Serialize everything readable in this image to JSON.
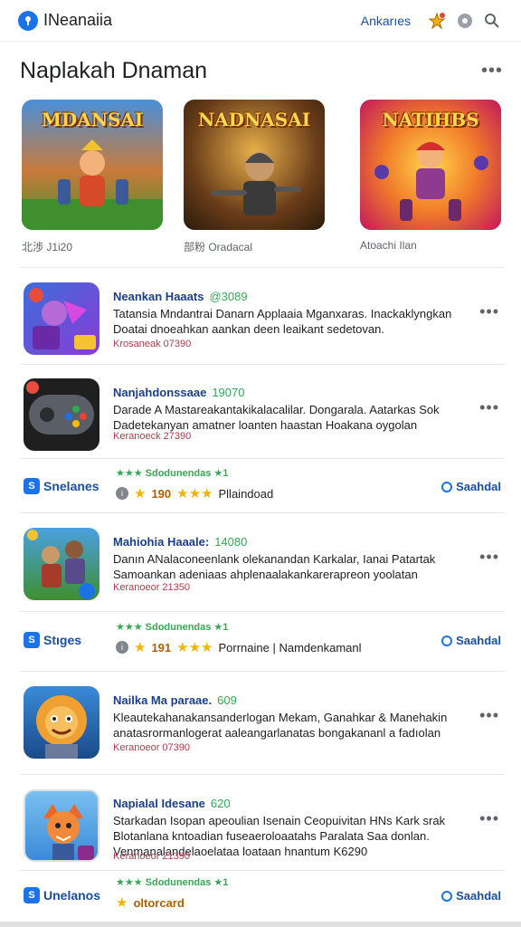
{
  "header": {
    "logo_letter": "●",
    "title": "INeanaiia",
    "link": "Ankarıes",
    "icons": [
      "star-badge-icon",
      "gear-icon",
      "search-icon"
    ]
  },
  "section": {
    "title": "Naplakah Dnaman",
    "more": "•••"
  },
  "featured": [
    {
      "art_title": "MDANSAI",
      "caption": "北渉 J1i20"
    },
    {
      "art_title": "NADNASAI",
      "caption": "部粉 Oradacal"
    },
    {
      "art_title": "NATIHBS",
      "caption": "Atoachi Ilan"
    }
  ],
  "items": [
    {
      "name": "Neankan Haaats",
      "code": "@3089",
      "desc": "Tatansia Mndantrai Danarn Applaaia Mganxaras. Inackaklyngkan Doatai dnoeahkan aankan deen leaikant sedetovan.",
      "meta": "Krosaneak 07390"
    },
    {
      "name": "Nanjahdonssaae",
      "code": "19070",
      "desc": "Darade A Mastareakantakikalacalilar. Dongarala. Aatarkas Sok Dadetekanyan amatner loanten haastan Hoakana oygolan",
      "meta": "Keranoeck 27390"
    },
    {
      "name": "Mahiohia Haaale:",
      "code": "14080",
      "desc": "Danın ANalaconeenlank olekanandan Karkalar, Ianai Patartak Samoankan adeniaas ahplenaalakankarerapreon yoolatan",
      "meta": "Keranoeor 21350"
    },
    {
      "name": "Nailka Ma paraae.",
      "code": "609",
      "desc": "Kleautekahanakansanderlogan Mekam, Ganahkar & Manehakin anatasrormanlogerat aaleangarlanatas bongakananl a fadıolan",
      "meta": "Keranoeor 07390"
    },
    {
      "name": "Napialal Idesane",
      "code": "620",
      "desc": "Starkadan Isopan apeoulian Isenain Ceopuivitan HNs Kark srak Blotanlana kntoadian fuseaeroloaatahs Paralata Saa donlan. Venmanalandelaoelataa loataan hnantum K6290",
      "meta": "Keranoeor 21390"
    }
  ],
  "promos": [
    {
      "label": "Snelanes",
      "stars_line": "★★★ Sdodunendas ★1",
      "rating_num": "190",
      "rating_text": "Pllaindoad",
      "action": "Saahdal"
    },
    {
      "label": "Stıges",
      "stars_line": "★★★ Sdodunendas ★1",
      "rating_num": "191",
      "rating_text": "Porrnaine | Namdenkamanl",
      "action": "Saahdal"
    },
    {
      "label": "Unelanos",
      "stars_line": "★★★ Sdodunendas ★1",
      "rating_num": "",
      "rating_text": "oltorcard",
      "action": "Saahdal"
    }
  ],
  "colors": {
    "accent": "#1a73e8",
    "link": "#1a4fa0",
    "green": "#34a853",
    "meta": "#b03a4a"
  }
}
